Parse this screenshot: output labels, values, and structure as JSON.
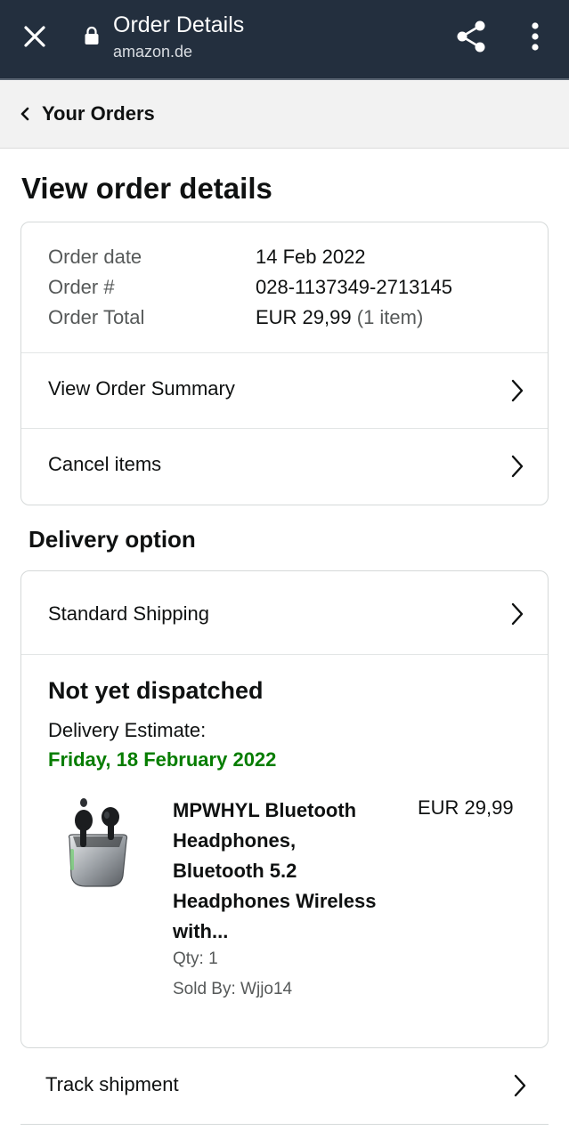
{
  "browser": {
    "title": "Order Details",
    "domain": "amazon.de",
    "icons": [
      "close-icon",
      "lock-icon",
      "share-icon",
      "more-vertical-icon"
    ]
  },
  "breadcrumb": {
    "label": "Your Orders"
  },
  "page_title": "View order details",
  "order": {
    "date_label": "Order date",
    "date_value": "14 Feb 2022",
    "number_label": "Order #",
    "number_value": "028-1137349-2713145",
    "total_label": "Order Total",
    "total_value": "EUR 29,99",
    "total_items": "(1 item)"
  },
  "actions": {
    "view_summary": "View Order Summary",
    "cancel_items": "Cancel items"
  },
  "delivery": {
    "section_title": "Delivery option",
    "shipping_method": "Standard Shipping",
    "status": "Not yet dispatched",
    "estimate_label": "Delivery Estimate:",
    "estimate_date": "Friday, 18 February 2022",
    "estimate_color": "#067d00"
  },
  "product": {
    "name_lines": [
      "MPWHYL Bluetooth",
      "Headphones,",
      "Bluetooth 5.2",
      "Headphones Wireless",
      "with..."
    ],
    "price": "EUR 29,99",
    "qty": "Qty: 1",
    "sold_by": "Sold By: Wjjo14"
  },
  "track": {
    "label": "Track shipment"
  },
  "colors": {
    "header_bg": "#232f3e",
    "link_text": "#0f1111",
    "muted": "#565959"
  }
}
